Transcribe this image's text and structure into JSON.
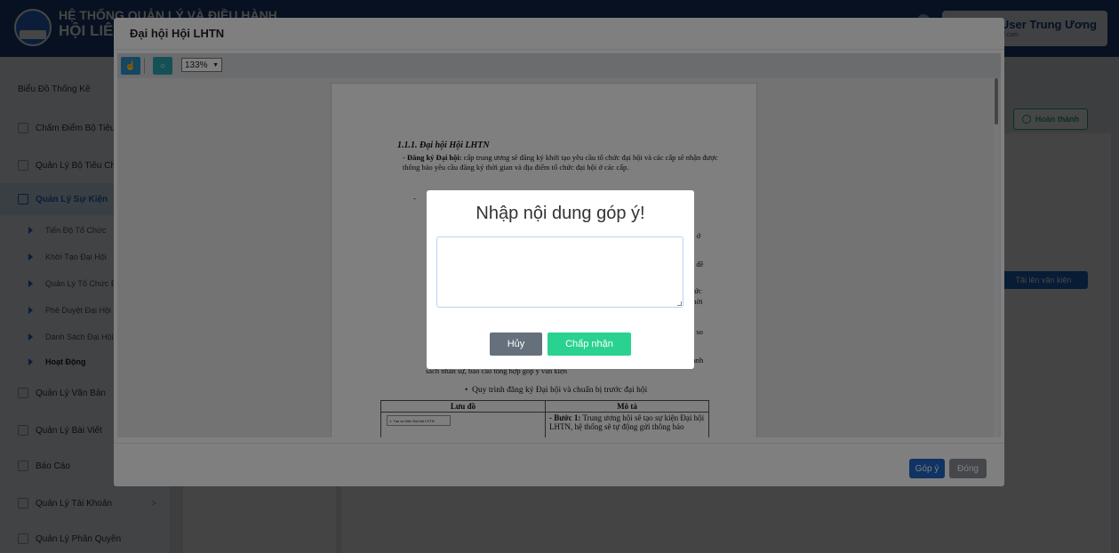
{
  "app": {
    "title_line1": "HỆ THỐNG QUẢN LÝ VÀ ĐIỀU HÀNH",
    "title_line2": "HỘI LIÊN",
    "user_name": "- User Trung Ương",
    "user_email": "gmail.com"
  },
  "sidebar": {
    "items": [
      {
        "label": "Biểu Đồ Thống Kê"
      },
      {
        "label": "Chấm Điểm Bộ Tiêu Chí"
      },
      {
        "label": "Quản Lý Bộ Tiêu Chí"
      },
      {
        "label": "Quản Lý Sự Kiện"
      },
      {
        "label": "Quản Lý Văn Bản"
      },
      {
        "label": "Quản Lý Bài Viết"
      },
      {
        "label": "Báo Cáo"
      },
      {
        "label": "Quản Lý Tài Khoản"
      },
      {
        "label": "Quản Lý Phân Quyền"
      }
    ],
    "subitems": [
      {
        "label": "Tiến Độ Tổ Chức"
      },
      {
        "label": "Khởi Tạo Đại Hội"
      },
      {
        "label": "Quản Lý Tổ Chức Đại"
      },
      {
        "label": "Phê Duyệt Đại Hội"
      },
      {
        "label": "Danh Sách Đại Hội"
      },
      {
        "label": "Hoạt Động"
      }
    ],
    "chevron": ">"
  },
  "page": {
    "done_button": "Hoàn thành",
    "upload_button": "Tải lên văn kiện"
  },
  "viewer": {
    "title": "Đại hội Hội LHTN",
    "zoom": "133%",
    "footer_feedback": "Góp ý",
    "footer_close": "Đóng",
    "doc": {
      "heading": "1.1.1. Đại hội Hội LHTN",
      "para1_label": "Đăng ký Đại hội:",
      "para1": "cấp trung ương sẽ đăng ký khởi tạo yêu cầu tổ chức đại hội và các cấp sẽ nhận được thông báo yêu cầu đăng ký thời gian và địa điểm tổ chức đại hội ở các cấp.",
      "dash": "-",
      "frag1": "vị ở",
      "frag2": "n đề",
      "frag3": "hức",
      "frag4": "thời",
      "frag5": "n so",
      "frag6": "anh",
      "line_partial": "sách nhân sự, báo cáo tổng hợp góp ý văn kiện",
      "bullet": "Quy trình đăng ký Đại hội và chuẩn bị trước đại hội",
      "table": {
        "col1": "Lưu đồ",
        "col2": "Mô tả",
        "flow_box": "1. Tạo sự kiện Đại hội LHTN",
        "step_label": "- Bước 1:",
        "step_text": "Trung ương hội sẽ tạo sự kiện Đại hội LHTN, hệ thống sẽ tự động gửi thông báo"
      }
    }
  },
  "dialog": {
    "title": "Nhập nội dung góp ý!",
    "textarea_value": "",
    "cancel": "Hủy",
    "accept": "Chấp nhận"
  }
}
